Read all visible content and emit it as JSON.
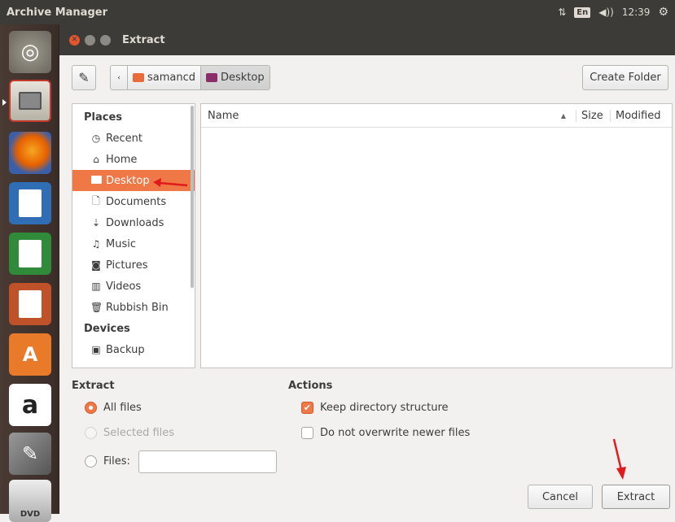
{
  "panel": {
    "app_title": "Archive Manager",
    "keyboard": "En",
    "time": "12:39"
  },
  "dialog": {
    "title": "Extract"
  },
  "toolbar": {
    "path": [
      "samancd",
      "Desktop"
    ],
    "create_folder": "Create Folder"
  },
  "places": {
    "places_header": "Places",
    "items": [
      {
        "label": "Recent",
        "icon": "clock-icon"
      },
      {
        "label": "Home",
        "icon": "home-icon"
      },
      {
        "label": "Desktop",
        "icon": "folder-icon",
        "selected": true
      },
      {
        "label": "Documents",
        "icon": "document-icon"
      },
      {
        "label": "Downloads",
        "icon": "download-icon"
      },
      {
        "label": "Music",
        "icon": "music-icon"
      },
      {
        "label": "Pictures",
        "icon": "camera-icon"
      },
      {
        "label": "Videos",
        "icon": "film-icon"
      },
      {
        "label": "Rubbish Bin",
        "icon": "trash-icon"
      }
    ],
    "devices_header": "Devices",
    "devices": [
      {
        "label": "Backup",
        "icon": "backup-icon"
      }
    ]
  },
  "file_list": {
    "columns": [
      "Name",
      "Size",
      "Modified"
    ],
    "rows": []
  },
  "extract": {
    "header": "Extract",
    "options": [
      "All files",
      "Selected files",
      "Files:"
    ],
    "selected": "All files",
    "files_value": ""
  },
  "actions": {
    "header": "Actions",
    "options": [
      {
        "label": "Keep directory structure",
        "checked": true
      },
      {
        "label": "Do not overwrite newer files",
        "checked": false
      }
    ]
  },
  "buttons": {
    "cancel": "Cancel",
    "extract": "Extract"
  },
  "colors": {
    "accent": "#f07746",
    "annotation": "#e01b1b"
  }
}
